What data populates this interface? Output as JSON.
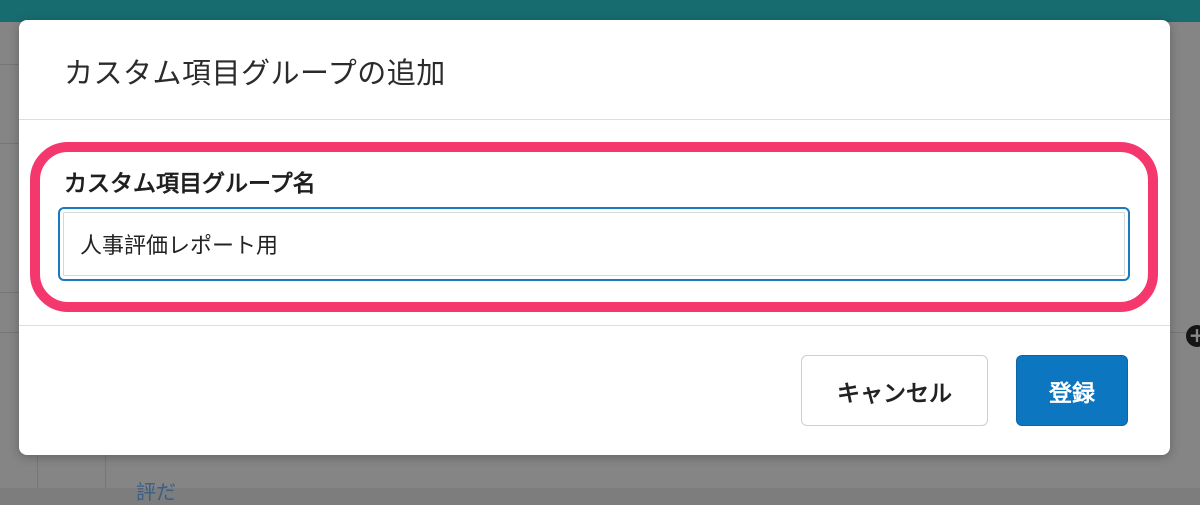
{
  "background": {
    "partial_link_text": "評だ"
  },
  "modal": {
    "title": "カスタム項目グループの追加",
    "field_label": "カスタム項目グループ名",
    "input_value": "人事評価レポート用",
    "cancel_label": "キャンセル",
    "submit_label": "登録"
  },
  "colors": {
    "topbar": "#176c6f",
    "highlight": "#f4376d",
    "primary_button": "#0d76c1",
    "input_focus_border": "#1a79bf"
  }
}
